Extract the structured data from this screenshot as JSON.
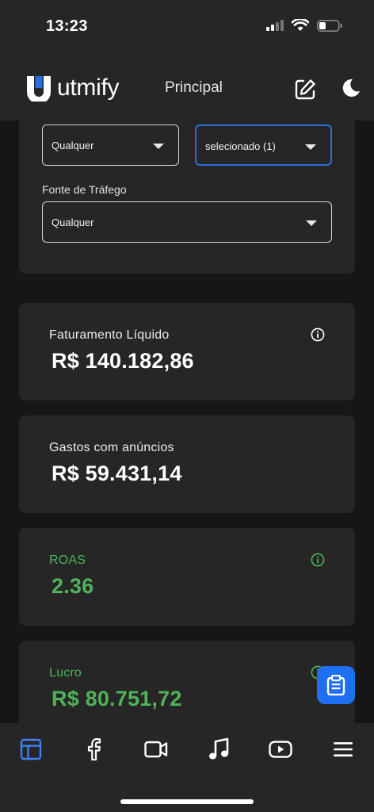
{
  "status_bar": {
    "time": "13:23"
  },
  "header": {
    "logo_text": "utmify",
    "title": "Principal"
  },
  "filters": {
    "select_left_value": "Qualquer",
    "select_right_value": "selecionado (1)",
    "traffic_source_label": "Fonte de Tráfego",
    "traffic_source_value": "Qualquer"
  },
  "metrics": {
    "net_revenue": {
      "label": "Faturamento Líquido",
      "value": "R$ 140.182,86"
    },
    "ad_spend": {
      "label": "Gastos com anúncios",
      "value": "R$ 59.431,14"
    },
    "roas": {
      "label": "ROAS",
      "value": "2.36"
    },
    "profit": {
      "label": "Lucro",
      "value": "R$ 80.751,72"
    }
  },
  "tabs": [
    {
      "icon": "dashboard-icon",
      "active": true
    },
    {
      "icon": "facebook-icon"
    },
    {
      "icon": "video-camera-icon"
    },
    {
      "icon": "music-note-icon"
    },
    {
      "icon": "youtube-icon"
    },
    {
      "icon": "menu-icon"
    }
  ],
  "colors": {
    "background": "#161616",
    "surface": "#262626",
    "accent_blue": "#1f6ff2",
    "positive_green": "#4fb35a"
  }
}
